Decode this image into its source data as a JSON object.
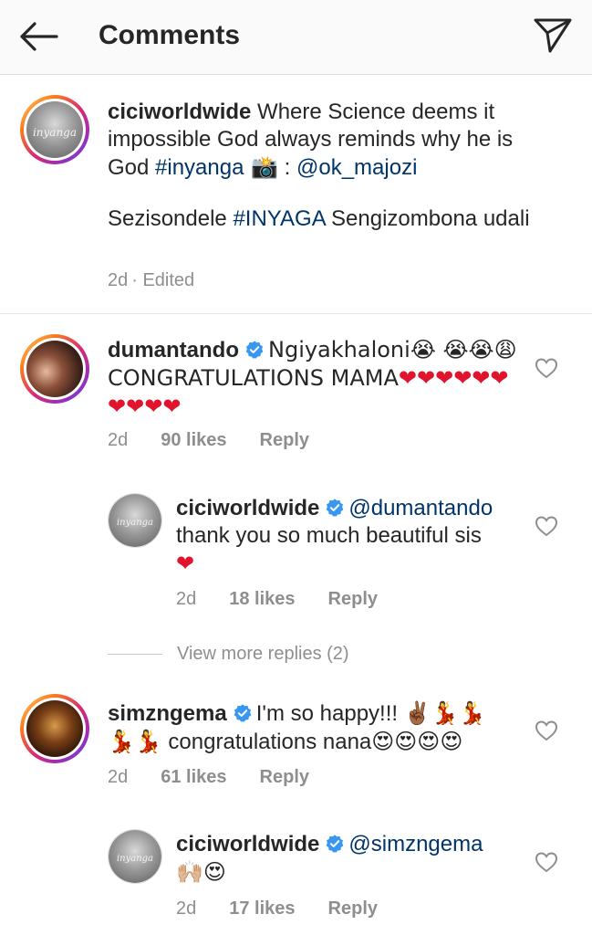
{
  "header": {
    "title": "Comments"
  },
  "caption": {
    "username": "ciciworldwide",
    "text_1": " Where Science deems it impossible God always reminds why he is God ",
    "hashtag_1": "#inyanga",
    "camera_emoji": " 📸",
    "text_2": " : ",
    "mention": "@ok_majozi",
    "line2_text": "Sezisondele ",
    "hashtag_2": "#INYAGA",
    "line2_rest": " Sengizombona udali",
    "time": "2d",
    "edited": "· Edited",
    "avatar_watermark": "inyanga"
  },
  "comments": [
    {
      "username": "dumantando",
      "verified": true,
      "text": "Ngiyakhaloni😭 😭😭😩 CONGRATULATIONS MAMA",
      "hearts": "❤❤❤❤❤❤❤❤❤❤",
      "time": "2d",
      "likes": "90 likes",
      "reply": "Reply"
    },
    {
      "username": "ciciworldwide",
      "verified": true,
      "mention": "@dumantando",
      "text": "thank you so much beautiful sis",
      "hearts": "❤",
      "time": "2d",
      "likes": "18 likes",
      "reply": "Reply",
      "avatar_watermark": "inyanga"
    },
    {
      "username": "simzngema",
      "verified": true,
      "text_1": "I'm so happy!!! ",
      "emoji_1": "✌🏾💃💃",
      "emoji_2": "💃💃",
      "text_2": " congratulations nana",
      "emoji_3": "😍😍😍😍",
      "time": "2d",
      "likes": "61 likes",
      "reply": "Reply"
    },
    {
      "username": "ciciworldwide",
      "verified": true,
      "mention": "@simzngema",
      "emoji": "🙌🏼😍",
      "time": "2d",
      "likes": "17 likes",
      "reply": "Reply",
      "avatar_watermark": "inyanga"
    }
  ],
  "view_more": "View more replies (2)",
  "colors": {
    "link": "#003569",
    "verified": "#3897f0",
    "meta": "#8e8e8e",
    "heart_red": "#e0142c"
  },
  "icons": [
    "back-arrow-icon",
    "send-icon",
    "verified-badge-icon",
    "heart-outline-icon"
  ]
}
